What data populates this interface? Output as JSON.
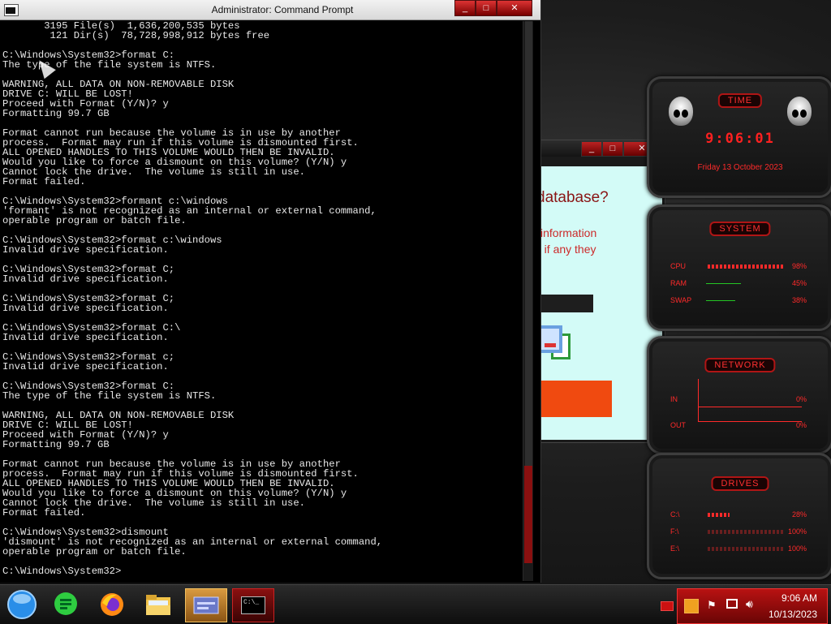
{
  "cmd": {
    "title": "Administrator: Command Prompt",
    "lines": [
      "       3195 File(s)  1,636,200,535 bytes",
      "        121 Dir(s)  78,728,998,912 bytes free",
      "",
      "C:\\Windows\\System32>format C:",
      "The type of the file system is NTFS.",
      "",
      "WARNING, ALL DATA ON NON-REMOVABLE DISK",
      "DRIVE C: WILL BE LOST!",
      "Proceed with Format (Y/N)? y",
      "Formatting 99.7 GB",
      "",
      "Format cannot run because the volume is in use by another",
      "process.  Format may run if this volume is dismounted first.",
      "ALL OPENED HANDLES TO THIS VOLUME WOULD THEN BE INVALID.",
      "Would you like to force a dismount on this volume? (Y/N) y",
      "Cannot lock the drive.  The volume is still in use.",
      "Format failed.",
      "",
      "C:\\Windows\\System32>formant c:\\windows",
      "'formant' is not recognized as an internal or external command,",
      "operable program or batch file.",
      "",
      "C:\\Windows\\System32>format c:\\windows",
      "Invalid drive specification.",
      "",
      "C:\\Windows\\System32>format C;",
      "Invalid drive specification.",
      "",
      "C:\\Windows\\System32>format C;",
      "Invalid drive specification.",
      "",
      "C:\\Windows\\System32>format C:\\",
      "Invalid drive specification.",
      "",
      "C:\\Windows\\System32>format c;",
      "Invalid drive specification.",
      "",
      "C:\\Windows\\System32>format C:",
      "The type of the file system is NTFS.",
      "",
      "WARNING, ALL DATA ON NON-REMOVABLE DISK",
      "DRIVE C: WILL BE LOST!",
      "Proceed with Format (Y/N)? y",
      "Formatting 99.7 GB",
      "",
      "Format cannot run because the volume is in use by another",
      "process.  Format may run if this volume is dismounted first.",
      "ALL OPENED HANDLES TO THIS VOLUME WOULD THEN BE INVALID.",
      "Would you like to force a dismount on this volume? (Y/N) y",
      "Cannot lock the drive.  The volume is still in use.",
      "Format failed.",
      "",
      "C:\\Windows\\System32>dismount",
      "'dismount' is not recognized as an internal or external command,",
      "operable program or batch file.",
      "",
      "C:\\Windows\\System32>"
    ],
    "window_buttons": {
      "minimize": "_",
      "maximize": "□",
      "close": "✕"
    }
  },
  "bgwin": {
    "heading": "database?",
    "text1": "information",
    "text2": "e if any they"
  },
  "gadgets": {
    "time": {
      "label": "TIME",
      "clock": "9:06:01",
      "date": "Friday 13 October 2023"
    },
    "system": {
      "label": "SYSTEM",
      "rows": [
        {
          "name": "CPU",
          "value": "98%",
          "level": 0.98
        },
        {
          "name": "RAM",
          "value": "45%",
          "level": 0.45
        },
        {
          "name": "SWAP",
          "value": "38%",
          "level": 0.38
        }
      ]
    },
    "network": {
      "label": "NETWORK",
      "in_label": "IN",
      "in_value": "0%",
      "out_label": "OUT",
      "out_value": "0%"
    },
    "drives": {
      "label": "DRIVES",
      "rows": [
        {
          "name": "C:\\",
          "value": "28%",
          "level": 0.28
        },
        {
          "name": "F:\\",
          "value": "100%",
          "level": 1.0
        },
        {
          "name": "E:\\",
          "value": "100%",
          "level": 1.0
        }
      ]
    }
  },
  "taskbar": {
    "clock_time": "9:06 AM",
    "clock_date": "10/13/2023",
    "cmd_icon_text": "C:\\_"
  },
  "colors": {
    "accent": "#ff2a2a",
    "cmd_bg": "#000000",
    "tray": "#b81212"
  }
}
